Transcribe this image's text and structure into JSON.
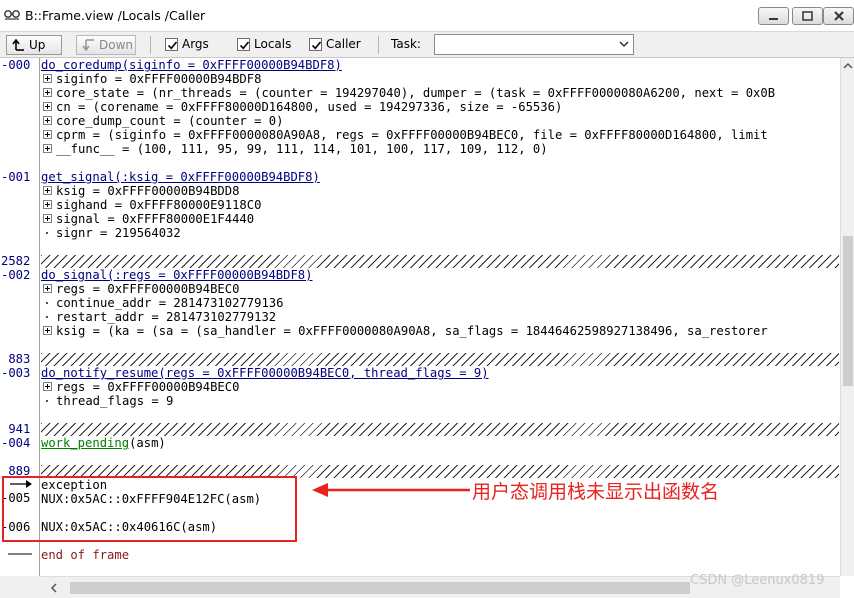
{
  "window": {
    "title": "B::Frame.view /Locals /Caller"
  },
  "toolbar": {
    "up_label": "Up",
    "down_label": "Down",
    "args_label": "Args",
    "locals_label": "Locals",
    "caller_label": "Caller",
    "args_checked": true,
    "locals_checked": true,
    "caller_checked": true,
    "task_label": "Task:",
    "task_value": ""
  },
  "gutter": {
    "n000": "-000",
    "n001": "-001",
    "addr2582": "2582",
    "n002": "-002",
    "addr883": " 883",
    "n003": "-003",
    "addr941": " 941",
    "n004": "-004",
    "addr889": " 889",
    "n005": "-005",
    "n006": "-006"
  },
  "frames": {
    "f000_head": "do_coredump(siginfo = 0xFFFF00000B94BDF8)",
    "f000_vars": [
      "siginfo = 0xFFFF00000B94BDF8",
      "core_state = (nr_threads = (counter = 194297040), dumper = (task = 0xFFFF0000080A6200, next = 0x0B",
      "cn = (corename = 0xFFFF80000D164800, used = 194297336, size = -65536)",
      "core_dump_count = (counter = 0)",
      "cprm = (siginfo = 0xFFFF0000080A90A8, regs = 0xFFFF00000B94BEC0, file = 0xFFFF80000D164800, limit",
      "__func__ = (100, 111, 95, 99, 111, 114, 101, 100, 117, 109, 112, 0)"
    ],
    "f001_head": "get_signal(:ksig = 0xFFFF00000B94BDF8)",
    "f001_vars": [
      "ksig = 0xFFFF00000B94BDD8",
      "sighand = 0xFFFF80000E9118C0",
      "signal = 0xFFFF80000E1F4440",
      "signr = 219564032"
    ],
    "f002_head": "do_signal(:regs = 0xFFFF00000B94BDF8)",
    "f002_vars": [
      "regs = 0xFFFF00000B94BEC0",
      "continue_addr = 281473102779136",
      "restart_addr = 281473102779132",
      "ksig = (ka = (sa = (sa_handler = 0xFFFF0000080A90A8, sa_flags = 18446462598927138496, sa_restorer"
    ],
    "f003_head": "do_notify_resume(regs = 0xFFFF00000B94BEC0, thread_flags = 9)",
    "f003_vars": [
      "regs = 0xFFFF00000B94BEC0",
      "thread_flags = 9"
    ],
    "f004_name": "work_pending",
    "f004_suffix": "(asm)",
    "exception": "exception",
    "f005": "NUX:0x5AC::0xFFFF904E12FC(asm)",
    "f006": "NUX:0x5AC::0x40616C(asm)",
    "end": "end of frame"
  },
  "annotation": {
    "text": "用户态调用栈未显示出函数名",
    "color": "#e8231e"
  },
  "watermark": "CSDN @Leenux0819"
}
